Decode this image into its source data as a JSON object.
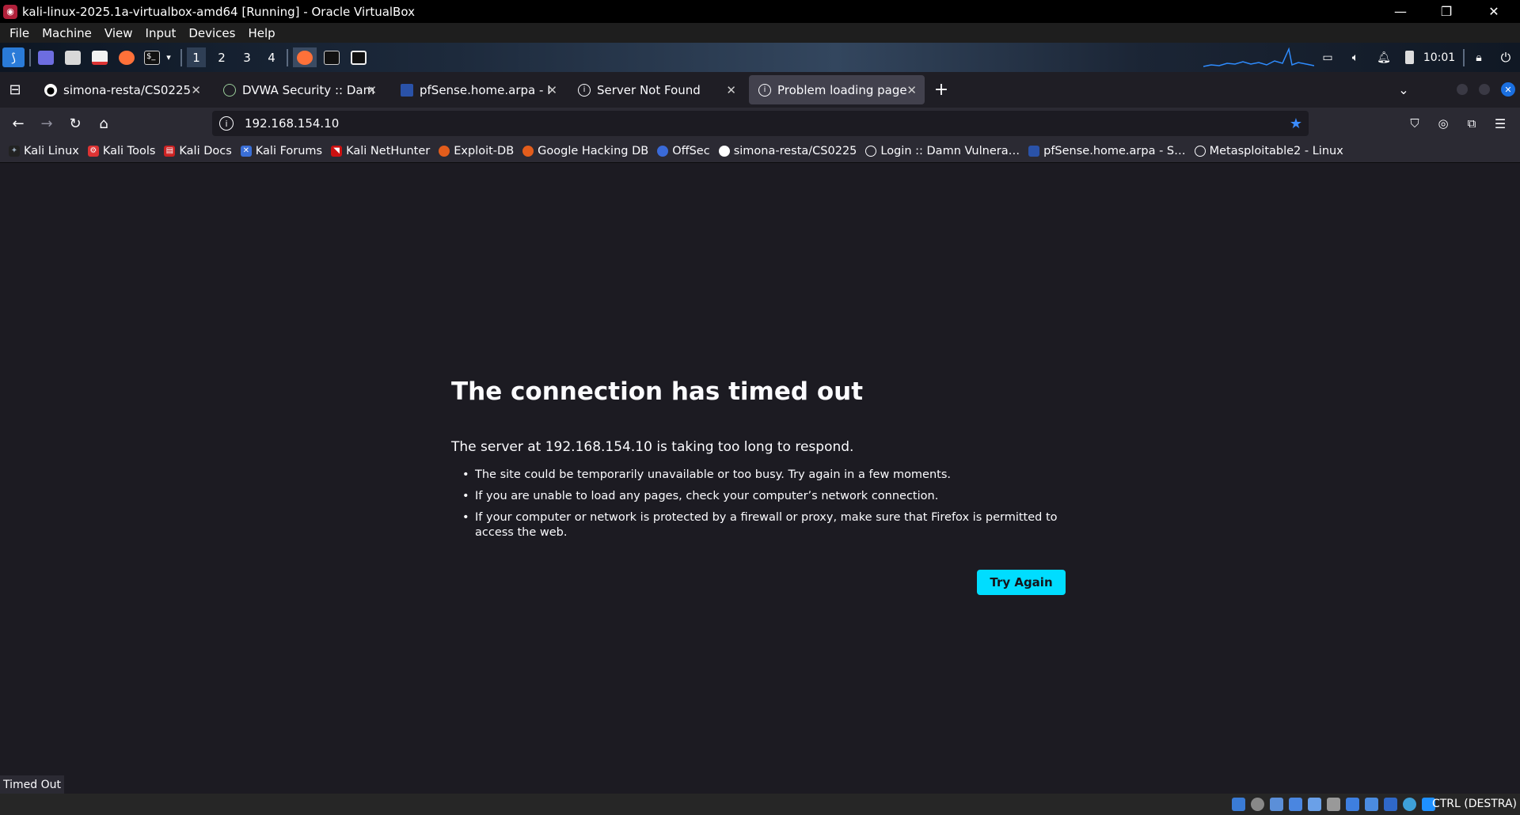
{
  "window": {
    "title": "kali-linux-2025.1a-virtualbox-amd64 [Running] - Oracle VirtualBox"
  },
  "menu": [
    "File",
    "Machine",
    "View",
    "Input",
    "Devices",
    "Help"
  ],
  "panel": {
    "workspaces": [
      "1",
      "2",
      "3",
      "4"
    ],
    "clock": "10:01"
  },
  "tabs": [
    {
      "label": "simona-resta/CS0225",
      "icon": "github-icon"
    },
    {
      "label": "DVWA Security :: Damn Vulnerable",
      "icon": "dvwa-icon"
    },
    {
      "label": "pfSense.home.arpa - Firewall",
      "icon": "pfsense-icon"
    },
    {
      "label": "Server Not Found",
      "icon": "info-icon"
    },
    {
      "label": "Problem loading page",
      "icon": "info-icon"
    }
  ],
  "navbar": {
    "url": "192.168.154.10"
  },
  "bookmarks": [
    "Kali Linux",
    "Kali Tools",
    "Kali Docs",
    "Kali Forums",
    "Kali NetHunter",
    "Exploit-DB",
    "Google Hacking DB",
    "OffSec",
    "simona-resta/CS0225",
    "Login :: Damn Vulnera…",
    "pfSense.home.arpa - S…",
    "Metasploitable2 - Linux"
  ],
  "error": {
    "title": "The connection has timed out",
    "description": "The server at 192.168.154.10 is taking too long to respond.",
    "suggestions": [
      "The site could be temporarily unavailable or too busy. Try again in a few moments.",
      "If you are unable to load any pages, check your computer’s network connection.",
      "If your computer or network is protected by a firewall or proxy, make sure that Firefox is permitted to access the web."
    ],
    "button": "Try Again"
  },
  "status_text": "Timed Out",
  "host_key": "CTRL (DESTRA)",
  "colors": {
    "accent_button": "#00ddff",
    "bookmark_star": "#3b8cff",
    "page_background": "#1c1b22"
  }
}
